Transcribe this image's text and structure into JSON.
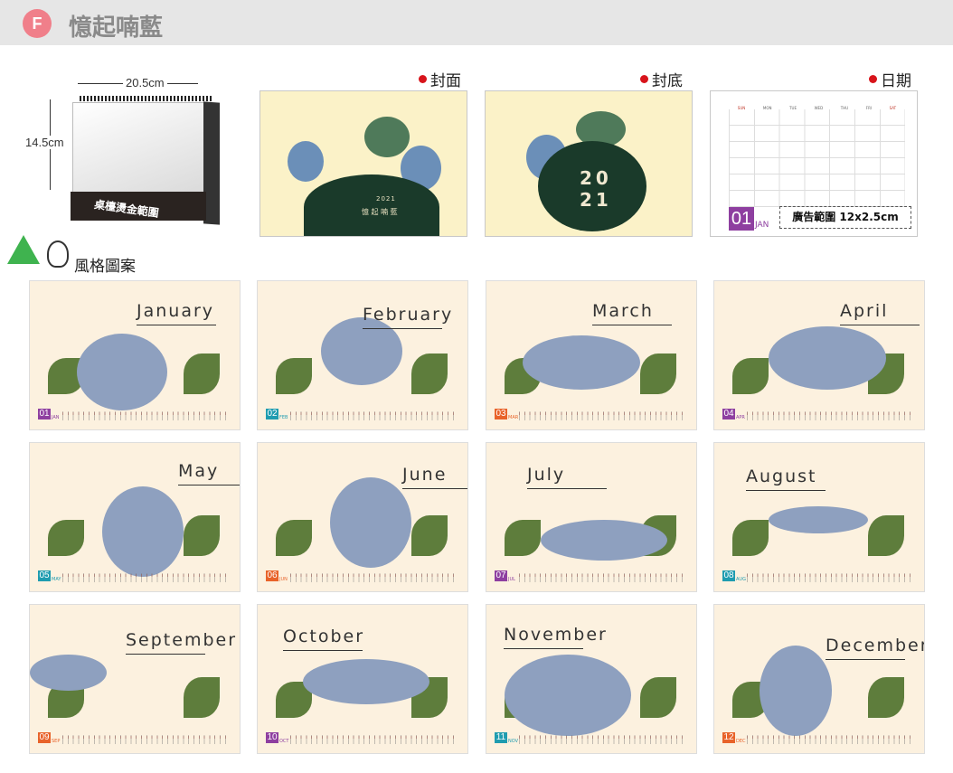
{
  "header": {
    "badge": "F",
    "title": "憶起喃藍"
  },
  "product": {
    "width_label": "20.5cm",
    "height_label": "14.5cm",
    "stand_label": "桌檯燙金範圍"
  },
  "previews": [
    {
      "label": "封面",
      "text_line1": "2021",
      "text_line2": "憶 起 喃 藍"
    },
    {
      "label": "封底",
      "text_line1": "20",
      "text_line2": "21"
    },
    {
      "label": "日期",
      "month_num": "01",
      "month_abbr": "JAN",
      "ad_text": "廣告範圍 12x2.5cm"
    }
  ],
  "calendar_days_header": [
    "SUN",
    "MON",
    "TUE",
    "WED",
    "THU",
    "FRI",
    "SAT"
  ],
  "style_label": "風格圖案",
  "months": [
    {
      "name": "January",
      "num": "01",
      "abbr": "JAN",
      "color": "#8e3fa0"
    },
    {
      "name": "February",
      "num": "02",
      "abbr": "FEB",
      "color": "#1f9cb0"
    },
    {
      "name": "March",
      "num": "03",
      "abbr": "MAR",
      "color": "#e8632a"
    },
    {
      "name": "April",
      "num": "04",
      "abbr": "APR",
      "color": "#8e3fa0"
    },
    {
      "name": "May",
      "num": "05",
      "abbr": "MAY",
      "color": "#1f9cb0"
    },
    {
      "name": "June",
      "num": "06",
      "abbr": "JUN",
      "color": "#e8632a"
    },
    {
      "name": "July",
      "num": "07",
      "abbr": "JUL",
      "color": "#8e3fa0"
    },
    {
      "name": "August",
      "num": "08",
      "abbr": "AUG",
      "color": "#1f9cb0"
    },
    {
      "name": "September",
      "num": "09",
      "abbr": "SEP",
      "color": "#e8632a"
    },
    {
      "name": "October",
      "num": "10",
      "abbr": "OCT",
      "color": "#8e3fa0"
    },
    {
      "name": "November",
      "num": "11",
      "abbr": "NOV",
      "color": "#1f9cb0"
    },
    {
      "name": "December",
      "num": "12",
      "abbr": "DEC",
      "color": "#e8632a"
    }
  ]
}
